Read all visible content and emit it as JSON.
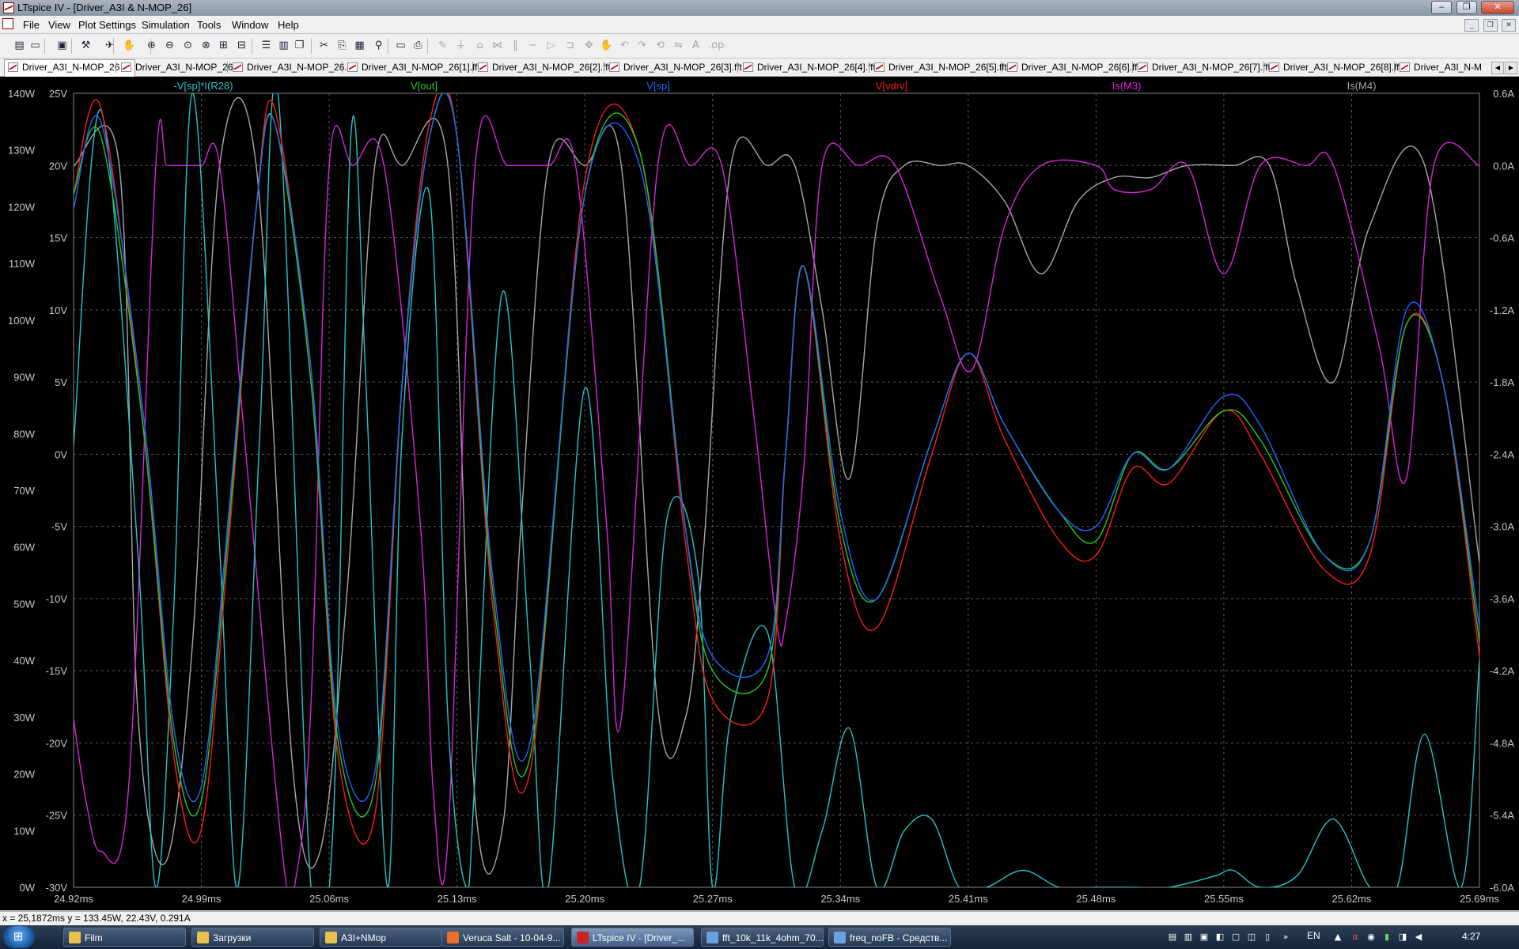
{
  "window": {
    "title": "LTspice IV - [Driver_A3I & N-MOP_26]",
    "controls": [
      "–",
      "❐",
      "✕"
    ]
  },
  "menu": [
    "File",
    "View",
    "Plot Settings",
    "Simulation",
    "Tools",
    "Window",
    "Help"
  ],
  "toolbar": {
    "icons": [
      "new-schematic-icon",
      "open-icon",
      "save-icon",
      "control-panel-icon",
      "run-icon",
      "halt-icon",
      "zoom-in-icon",
      "zoom-out-icon",
      "zoom-full-icon",
      "zoom-cancel-icon",
      "autoscale-icon",
      "add-trace-icon",
      "tile-horizontal-icon",
      "tile-vertical-icon",
      "cascade-icon",
      "cut-icon",
      "copy-icon",
      "paste-icon",
      "find-icon",
      "print-preview-icon",
      "print-icon",
      "wire-icon",
      "ground-icon",
      "label-icon",
      "resistor-icon",
      "capacitor-icon",
      "inductor-icon",
      "diode-icon",
      "component-icon",
      "move-icon",
      "drag-icon",
      "undo-icon",
      "redo-icon",
      "rotate-icon",
      "mirror-icon",
      "text-icon",
      "spice-directive-icon"
    ]
  },
  "tabs": [
    "Driver_A3I_N-MOP_26",
    "Driver_A3I_N-MOP_26",
    "Driver_A3I_N-MOP_26.fft",
    "Driver_A3I_N-MOP_26[1].fft",
    "Driver_A3I_N-MOP_26[2].fft",
    "Driver_A3I_N-MOP_26[3].fft",
    "Driver_A3I_N-MOP_26[4].fft",
    "Driver_A3I_N-MOP_26[5].fft",
    "Driver_A3I_N-MOP_26[6].fft",
    "Driver_A3I_N-MOP_26[7].fft",
    "Driver_A3I_N-MOP_26[8].fft",
    "Driver_A3I_N-M"
  ],
  "colors": {
    "cyan": "#22c7c7",
    "green": "#22cc22",
    "blue": "#2266ff",
    "red": "#ff1a1a",
    "magenta": "#dd22dd",
    "gray": "#a8a8a8",
    "grid": "#5a5a5a",
    "axis_text": "#c8c8c8"
  },
  "chart_data": {
    "type": "line",
    "x_unit": "ms",
    "xlim": [
      24.92,
      25.69
    ],
    "x_ticks": [
      "24.92ms",
      "24.99ms",
      "25.06ms",
      "25.13ms",
      "25.20ms",
      "25.27ms",
      "25.34ms",
      "25.41ms",
      "25.48ms",
      "25.55ms",
      "25.62ms",
      "25.69ms"
    ],
    "y_axes": {
      "power_W": {
        "lim": [
          0,
          140
        ],
        "ticks": [
          "140W",
          "130W",
          "120W",
          "110W",
          "100W",
          "90W",
          "80W",
          "70W",
          "60W",
          "50W",
          "40W",
          "30W",
          "20W",
          "10W",
          "0W"
        ]
      },
      "voltage_V": {
        "lim": [
          -30,
          25
        ],
        "ticks": [
          "25V",
          "20V",
          "15V",
          "10V",
          "5V",
          "0V",
          "-5V",
          "-10V",
          "-15V",
          "-20V",
          "-25V",
          "-30V"
        ]
      },
      "current_A": {
        "lim": [
          -6.0,
          0.6
        ],
        "ticks": [
          "0.6A",
          "0.0A",
          "-0.6A",
          "-1.2A",
          "-1.8A",
          "-2.4A",
          "-3.0A",
          "-3.6A",
          "-4.2A",
          "-4.8A",
          "-5.4A",
          "-6.0A"
        ]
      }
    },
    "series": [
      {
        "name": "-V[sp]*I(R28)",
        "axis": "power_W",
        "color": "cyan",
        "x": [
          24.92,
          24.935,
          24.955,
          24.965,
          24.975,
          24.985,
          25.0,
          25.01,
          25.022,
          25.032,
          25.05,
          25.062,
          25.072,
          25.08,
          25.092,
          25.1,
          25.115,
          25.125,
          25.135,
          25.14,
          25.155,
          25.17,
          25.18,
          25.2,
          25.215,
          25.23,
          25.245,
          25.262,
          25.27,
          25.28,
          25.3,
          25.315,
          25.33,
          25.345,
          25.36,
          25.375,
          25.39,
          25.405,
          25.42,
          25.44,
          25.46,
          25.48,
          25.5,
          25.52,
          25.545,
          25.555,
          25.57,
          25.59,
          25.61,
          25.63,
          25.645,
          25.66,
          25.68,
          25.69
        ],
        "y": [
          78,
          137,
          60,
          0,
          50,
          140,
          60,
          0,
          80,
          140,
          0,
          10,
          133,
          90,
          0,
          80,
          122,
          30,
          0,
          20,
          105,
          40,
          0,
          88,
          20,
          0,
          65,
          55,
          0,
          30,
          45,
          0,
          10,
          28,
          0,
          10,
          12,
          0,
          0,
          3,
          0,
          0,
          0,
          0,
          2,
          3,
          0,
          2,
          12,
          0,
          0,
          27,
          0,
          40
        ]
      },
      {
        "name": "V[out]",
        "axis": "voltage_V",
        "color": "green",
        "x": [
          24.92,
          24.935,
          24.958,
          24.975,
          24.99,
          25.005,
          25.02,
          25.03,
          25.05,
          25.065,
          25.085,
          25.1,
          25.115,
          25.13,
          25.15,
          25.17,
          25.2,
          25.23,
          25.255,
          25.27,
          25.3,
          25.31,
          25.32,
          25.34,
          25.36,
          25.39,
          25.41,
          25.43,
          25.46,
          25.48,
          25.5,
          25.52,
          25.55,
          25.57,
          25.605,
          25.63,
          25.65,
          25.67,
          25.69
        ],
        "y": [
          18,
          22,
          2,
          -20,
          -24,
          -5,
          17,
          23,
          5,
          -20,
          -23,
          5,
          22,
          22,
          -10,
          -21,
          18,
          21,
          -5,
          -15,
          -15,
          0,
          13,
          -5,
          -10,
          1,
          7,
          2,
          -4,
          -6,
          0,
          -1,
          3,
          1,
          -7,
          -6,
          9,
          5,
          -13
        ]
      },
      {
        "name": "V[sp]",
        "axis": "voltage_V",
        "color": "blue",
        "x": [
          24.92,
          24.935,
          24.958,
          24.975,
          24.99,
          25.005,
          25.02,
          25.03,
          25.05,
          25.065,
          25.085,
          25.1,
          25.115,
          25.13,
          25.15,
          25.17,
          25.2,
          25.23,
          25.255,
          25.27,
          25.3,
          25.31,
          25.32,
          25.34,
          25.36,
          25.39,
          25.41,
          25.43,
          25.46,
          25.48,
          25.5,
          25.52,
          25.55,
          25.57,
          25.605,
          25.63,
          25.65,
          25.67,
          25.69
        ],
        "y": [
          17,
          23,
          3,
          -19,
          -23,
          -4,
          17,
          23,
          6,
          -19,
          -22,
          5,
          22,
          22,
          -9,
          -20,
          18,
          20,
          -5,
          -14,
          -14,
          0,
          13,
          -4,
          -10,
          1,
          7,
          2,
          -4,
          -5,
          0,
          -1,
          4,
          2,
          -7,
          -6,
          10,
          5,
          -12
        ]
      },
      {
        "name": "V[vdrv]",
        "axis": "voltage_V",
        "color": "red",
        "x": [
          24.92,
          24.935,
          24.958,
          24.975,
          24.99,
          25.005,
          25.02,
          25.03,
          25.05,
          25.065,
          25.085,
          25.1,
          25.115,
          25.13,
          25.15,
          25.17,
          25.2,
          25.23,
          25.255,
          25.27,
          25.3,
          25.31,
          25.32,
          25.34,
          25.36,
          25.39,
          25.41,
          25.43,
          25.46,
          25.48,
          25.5,
          25.52,
          25.55,
          25.57,
          25.605,
          25.63,
          25.65,
          25.67,
          25.69
        ],
        "y": [
          18,
          24,
          2,
          -21,
          -26,
          -6,
          17,
          24,
          5,
          -21,
          -25,
          5,
          23,
          22,
          -11,
          -22,
          19,
          21,
          -6,
          -17,
          -17,
          0,
          13,
          -6,
          -12,
          0,
          7,
          1,
          -6,
          -7,
          -1,
          -2,
          3,
          0,
          -8,
          -7,
          9,
          5,
          -14
        ]
      },
      {
        "name": "Is(M3)",
        "axis": "current_A",
        "color": "magenta",
        "x": [
          24.92,
          24.927,
          24.935,
          24.95,
          24.965,
          24.971,
          24.98,
          24.99,
          25.0,
          25.015,
          25.035,
          25.042,
          25.05,
          25.06,
          25.073,
          25.09,
          25.11,
          25.117,
          25.125,
          25.14,
          25.158,
          25.18,
          25.195,
          25.212,
          25.22,
          25.24,
          25.258,
          25.275,
          25.292,
          25.305,
          25.31,
          25.32,
          25.33,
          25.35,
          25.37,
          25.395,
          25.412,
          25.43,
          25.45,
          25.48,
          25.49,
          25.51,
          25.53,
          25.55,
          25.57,
          25.595,
          25.61,
          25.635,
          25.65,
          25.665,
          25.69
        ],
        "y": [
          -4.6,
          -5.3,
          -5.7,
          -5.2,
          0.0,
          0.0,
          0.0,
          0.0,
          0.0,
          -2.5,
          -5.8,
          -5.9,
          -4.5,
          0.0,
          0.0,
          0.0,
          -3.0,
          -5.2,
          -5.6,
          0.0,
          0.0,
          0.0,
          0.0,
          -3.0,
          -4.6,
          0.0,
          0.0,
          0.0,
          -2.0,
          -3.8,
          -3.8,
          -2.5,
          0.0,
          0.0,
          0.0,
          -1.1,
          -1.7,
          -0.5,
          0.0,
          0.0,
          -0.2,
          -0.2,
          0.0,
          -0.9,
          0.0,
          0.0,
          0.0,
          -1.5,
          -2.6,
          0.0,
          0.0
        ]
      },
      {
        "name": "Is(M4)",
        "axis": "current_A",
        "color": "gray",
        "x": [
          24.92,
          24.945,
          24.955,
          24.97,
          24.985,
          25.0,
          25.02,
          25.04,
          25.055,
          25.07,
          25.085,
          25.1,
          25.125,
          25.14,
          25.155,
          25.165,
          25.18,
          25.2,
          25.22,
          25.24,
          25.255,
          25.265,
          25.28,
          25.3,
          25.315,
          25.33,
          25.345,
          25.36,
          25.375,
          25.395,
          25.41,
          25.43,
          25.45,
          25.47,
          25.49,
          25.51,
          25.53,
          25.555,
          25.575,
          25.59,
          25.61,
          25.63,
          25.66,
          25.69
        ],
        "y": [
          0.0,
          0.0,
          -4.5,
          -5.8,
          -4.0,
          0.0,
          0.0,
          -5.0,
          -5.7,
          -3.5,
          0.0,
          0.0,
          0.0,
          -5.3,
          -5.5,
          -3.0,
          0.0,
          0.0,
          0.0,
          -4.5,
          -4.6,
          -3.2,
          0.0,
          0.0,
          0.0,
          -1.2,
          -2.6,
          -0.5,
          0.0,
          0.0,
          0.0,
          -0.3,
          -0.9,
          -0.3,
          -0.1,
          -0.1,
          0.0,
          0.0,
          0.0,
          -1.0,
          -1.8,
          -0.5,
          0.0,
          -3.3
        ]
      }
    ]
  },
  "status": {
    "cursor": "x = 25,1872ms   y = 133.45W, 22.43V, 0.291A"
  },
  "taskbar": {
    "items": [
      {
        "label": "Film",
        "color": "#e8c050"
      },
      {
        "label": "Загрузки",
        "color": "#e8c050"
      },
      {
        "label": "A3I+NMop",
        "color": "#e8c050"
      },
      {
        "label": "Veruca Salt - 10-04-9...",
        "color": "#e8702a"
      },
      {
        "label": "LTspice IV - [Driver_...",
        "color": "#cc2222"
      },
      {
        "label": "fft_10k_11k_4ohm_70...",
        "color": "#6aa0e0"
      },
      {
        "label": "freq_noFB - Средств...",
        "color": "#6aa0e0"
      }
    ],
    "lang": "EN",
    "clock": "4:27"
  }
}
